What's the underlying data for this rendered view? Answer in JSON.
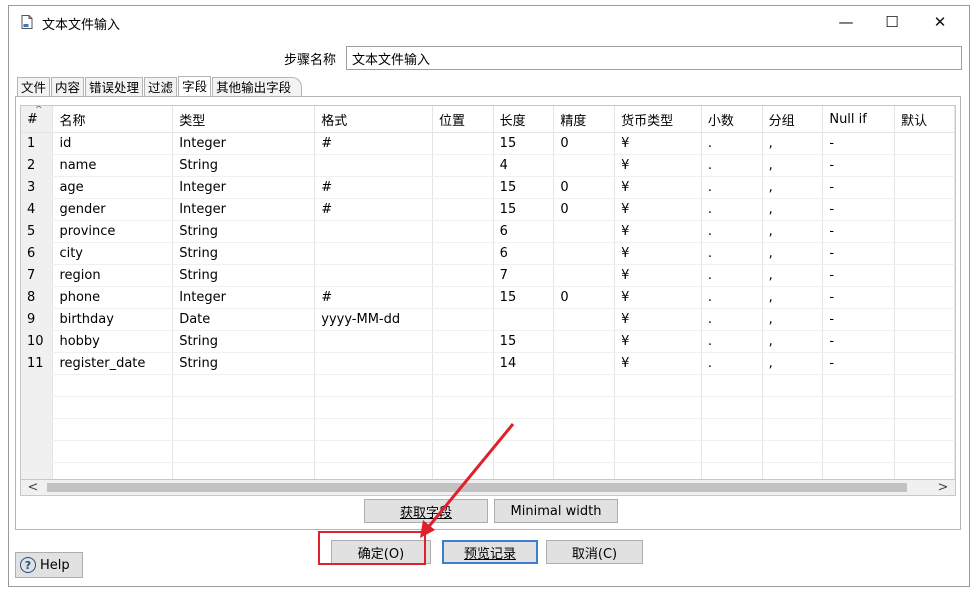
{
  "window": {
    "title": "文本文件输入",
    "minimize_glyph": "—",
    "maximize_glyph": "☐",
    "close_glyph": "✕"
  },
  "step_name": {
    "label": "步骤名称",
    "value": "文本文件输入"
  },
  "tabs": [
    {
      "label": "文件",
      "active": false
    },
    {
      "label": "内容",
      "active": false
    },
    {
      "label": "错误处理",
      "active": false
    },
    {
      "label": "过滤",
      "active": false
    },
    {
      "label": "字段",
      "active": true
    },
    {
      "label": "其他输出字段",
      "active": false
    }
  ],
  "table": {
    "columns": [
      "#",
      "名称",
      "类型",
      "格式",
      "位置",
      "长度",
      "精度",
      "货币类型",
      "小数",
      "分组",
      "Null if",
      "默认"
    ],
    "rows": [
      [
        "1",
        "id",
        "Integer",
        "#",
        "",
        "15",
        "0",
        "¥",
        ".",
        ",",
        "-",
        ""
      ],
      [
        "2",
        "name",
        "String",
        "",
        "",
        "4",
        "",
        "¥",
        ".",
        ",",
        "-",
        ""
      ],
      [
        "3",
        "age",
        "Integer",
        "#",
        "",
        "15",
        "0",
        "¥",
        ".",
        ",",
        "-",
        ""
      ],
      [
        "4",
        "gender",
        "Integer",
        "#",
        "",
        "15",
        "0",
        "¥",
        ".",
        ",",
        "-",
        ""
      ],
      [
        "5",
        "province",
        "String",
        "",
        "",
        "6",
        "",
        "¥",
        ".",
        ",",
        "-",
        ""
      ],
      [
        "6",
        "city",
        "String",
        "",
        "",
        "6",
        "",
        "¥",
        ".",
        ",",
        "-",
        ""
      ],
      [
        "7",
        "region",
        "String",
        "",
        "",
        "7",
        "",
        "¥",
        ".",
        ",",
        "-",
        ""
      ],
      [
        "8",
        "phone",
        "Integer",
        "#",
        "",
        "15",
        "0",
        "¥",
        ".",
        ",",
        "-",
        ""
      ],
      [
        "9",
        "birthday",
        "Date",
        "yyyy-MM-dd",
        "",
        "",
        "",
        "¥",
        ".",
        ",",
        "-",
        ""
      ],
      [
        "10",
        "hobby",
        "String",
        "",
        "",
        "15",
        "",
        "¥",
        ".",
        ",",
        "-",
        ""
      ],
      [
        "11",
        "register_date",
        "String",
        "",
        "",
        "14",
        "",
        "¥",
        ".",
        ",",
        "-",
        ""
      ]
    ],
    "empty_rows": 6
  },
  "scrollbar": {
    "left_glyph": "<",
    "right_glyph": ">"
  },
  "buttons": {
    "get_fields": "获取字段",
    "minimal_width": "Minimal width",
    "ok": "确定(O)",
    "preview": "预览记录",
    "cancel": "取消(C)",
    "help": "Help",
    "help_icon": "?"
  },
  "annotation_color": "#e0202a"
}
